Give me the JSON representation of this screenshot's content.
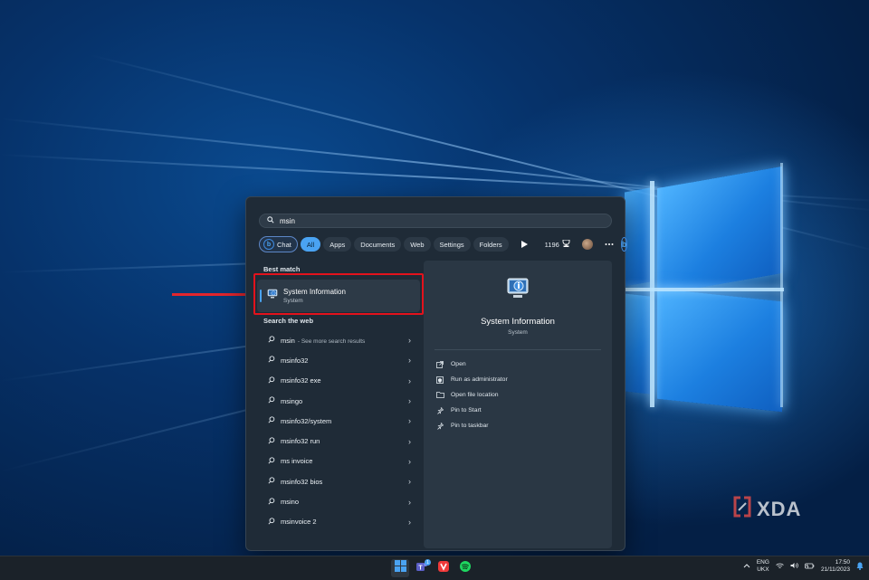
{
  "search": {
    "value": "msin",
    "placeholder": ""
  },
  "filters": {
    "chat": "Chat",
    "chips": [
      "All",
      "Apps",
      "Documents",
      "Web",
      "Settings",
      "Folders"
    ],
    "points": "1196"
  },
  "best_match": {
    "heading": "Best match",
    "title": "System Information",
    "subtitle": "System"
  },
  "web": {
    "heading": "Search the web",
    "items": [
      {
        "label": "msin",
        "hint": "- See more search results"
      },
      {
        "label": "msinfo32",
        "hint": ""
      },
      {
        "label": "msinfo32 exe",
        "hint": ""
      },
      {
        "label": "msingo",
        "hint": ""
      },
      {
        "label": "msinfo32/system",
        "hint": ""
      },
      {
        "label": "msinfo32 run",
        "hint": ""
      },
      {
        "label": "ms invoice",
        "hint": ""
      },
      {
        "label": "msinfo32 bios",
        "hint": ""
      },
      {
        "label": "msino",
        "hint": ""
      },
      {
        "label": "msinvoice 2",
        "hint": ""
      }
    ]
  },
  "detail": {
    "title": "System Information",
    "subtitle": "System",
    "actions": [
      {
        "label": "Open",
        "icon": "open-icon"
      },
      {
        "label": "Run as administrator",
        "icon": "shield-icon"
      },
      {
        "label": "Open file location",
        "icon": "folder-icon"
      },
      {
        "label": "Pin to Start",
        "icon": "pin-icon"
      },
      {
        "label": "Pin to taskbar",
        "icon": "pin-icon"
      }
    ]
  },
  "watermark": {
    "text": "XDA"
  },
  "taskbar": {
    "teams_badge": "1",
    "lang_top": "ENG",
    "lang_bottom": "UKX",
    "time": "17:50",
    "date": "21/11/2023"
  },
  "colors": {
    "accent": "#4aa3f2",
    "annotation_red": "#e3121c",
    "panel_bg": "#1f2b37",
    "detail_bg": "#2a3744"
  }
}
